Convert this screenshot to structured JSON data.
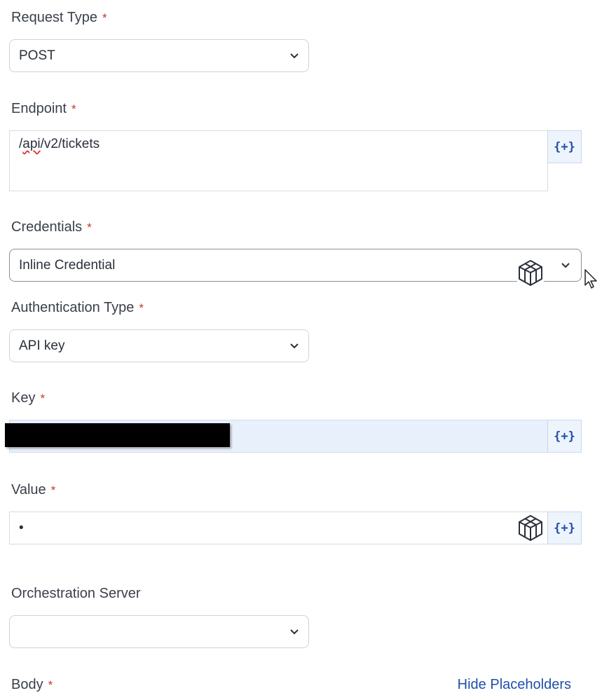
{
  "request_type": {
    "label": "Request Type",
    "value": "POST"
  },
  "endpoint": {
    "label": "Endpoint",
    "value_prefix": "/",
    "value_spell": "api",
    "value_rest": "/v2/tickets",
    "placeholder_button": "{+}"
  },
  "credentials": {
    "label": "Credentials",
    "value": "Inline Credential"
  },
  "auth_type": {
    "label": "Authentication Type",
    "value": "API key"
  },
  "key": {
    "label": "Key",
    "placeholder_button": "{+}"
  },
  "value_field": {
    "label": "Value",
    "value": "•",
    "placeholder_button": "{+}"
  },
  "orchestration": {
    "label": "Orchestration Server",
    "value": ""
  },
  "body": {
    "label": "Body",
    "hide_placeholders_link": "Hide Placeholders"
  },
  "required_marker": "*",
  "icons": [
    "chevron-down-icon",
    "cube-icon",
    "mouse-cursor-icon"
  ],
  "colors": {
    "accent": "#1f4fa8",
    "required": "#c0392b",
    "key_field_bg": "#e8f0fb",
    "redaction": "#000000"
  }
}
